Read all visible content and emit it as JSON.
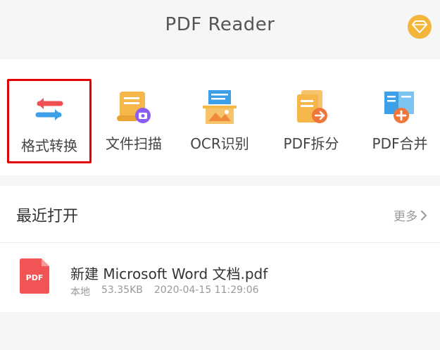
{
  "header": {
    "title": "PDF Reader",
    "vip_icon": "diamond-icon",
    "vip_color": "#f3b63a"
  },
  "tools": [
    {
      "label": "格式转换",
      "icon": "convert-arrows-icon",
      "selected": true
    },
    {
      "label": "文件扫描",
      "icon": "scan-scroll-icon",
      "selected": false
    },
    {
      "label": "OCR识别",
      "icon": "ocr-image-icon",
      "selected": false
    },
    {
      "label": "PDF拆分",
      "icon": "split-doc-icon",
      "selected": false
    },
    {
      "label": "PDF合并",
      "icon": "merge-doc-icon",
      "selected": false
    }
  ],
  "recent": {
    "title": "最近打开",
    "more_label": "更多"
  },
  "files": [
    {
      "name": "新建 Microsoft Word 文档.pdf",
      "location": "本地",
      "size": "53.35KB",
      "date": "2020-04-15 11:29:06",
      "badge": "PDF"
    }
  ],
  "colors": {
    "selection_border": "#e00000",
    "pdf_red": "#f05454"
  }
}
